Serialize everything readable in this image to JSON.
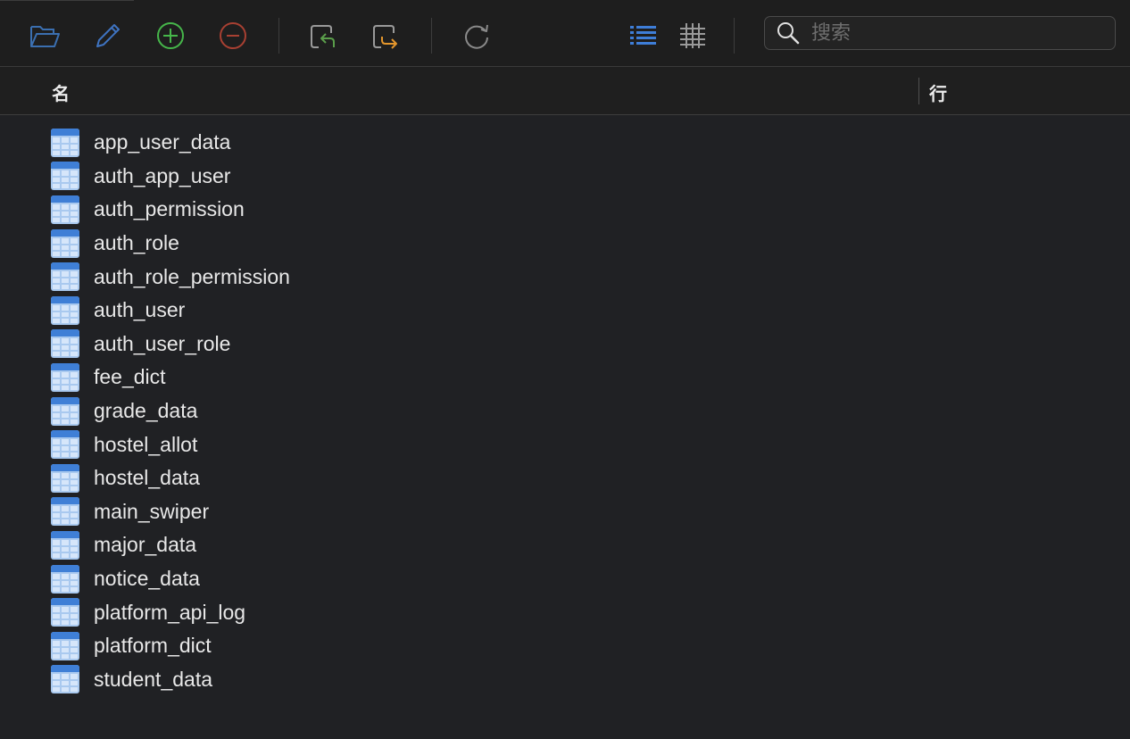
{
  "toolbar": {
    "buttons": [
      "folder-open",
      "edit",
      "add",
      "remove",
      "import",
      "export",
      "refresh",
      "list-view",
      "grid-view"
    ],
    "colors": {
      "folder": "#3b6fb0",
      "edit": "#3f74c2",
      "add": "#46b64a",
      "remove": "#a84032",
      "import": "#5a9e4a",
      "export": "#e4962c",
      "refresh": "#8a8a8a",
      "list_view_active": "#3e7ed8",
      "grid_view": "#9a9a9a"
    }
  },
  "search": {
    "placeholder": "搜索",
    "value": ""
  },
  "columns": {
    "name": "名",
    "rows": "行"
  },
  "tables": [
    "app_user_data",
    "auth_app_user",
    "auth_permission",
    "auth_role",
    "auth_role_permission",
    "auth_user",
    "auth_user_role",
    "fee_dict",
    "grade_data",
    "hostel_allot",
    "hostel_data",
    "main_swiper",
    "major_data",
    "notice_data",
    "platform_api_log",
    "platform_dict",
    "student_data"
  ],
  "row_counts": []
}
